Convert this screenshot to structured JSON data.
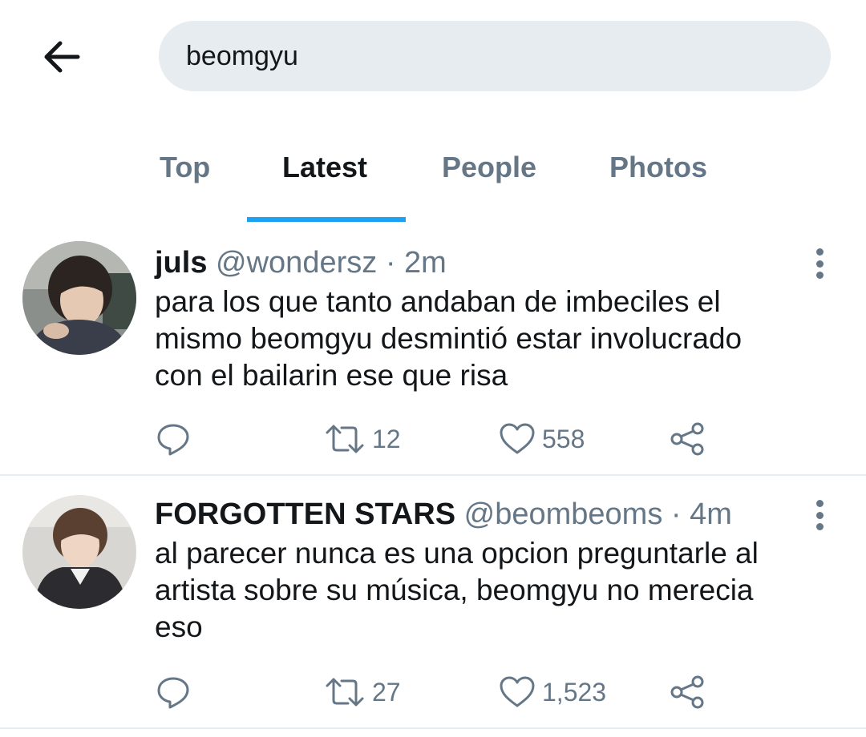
{
  "header": {
    "back_icon": "arrow-left-icon",
    "search_value": "beomgyu"
  },
  "tabs": [
    {
      "label": "Top",
      "active": false
    },
    {
      "label": "Latest",
      "active": true
    },
    {
      "label": "People",
      "active": false
    },
    {
      "label": "Photos",
      "active": false
    }
  ],
  "colors": {
    "accent": "#1da1f2",
    "secondary_text": "#657786",
    "search_bg": "#e6ecf0"
  },
  "tweets": [
    {
      "name": "juls",
      "handle": "@wondersz",
      "separator": "·",
      "time": "2m",
      "text_lines": [
        "para los que tanto andaban de imbeciles el",
        "mismo beomgyu desmintió estar involucrado",
        "con el bailarin ese que risa"
      ],
      "replies": "",
      "retweets": "12",
      "likes": "558"
    },
    {
      "name": "FORGOTTEN STARS",
      "handle": "@beombeoms",
      "separator": "·",
      "time": "4m",
      "text_lines": [
        "al parecer nunca es una opcion preguntarle al",
        "artista sobre su música, beomgyu no merecia",
        "eso"
      ],
      "replies": "",
      "retweets": "27",
      "likes": "1,523"
    }
  ]
}
